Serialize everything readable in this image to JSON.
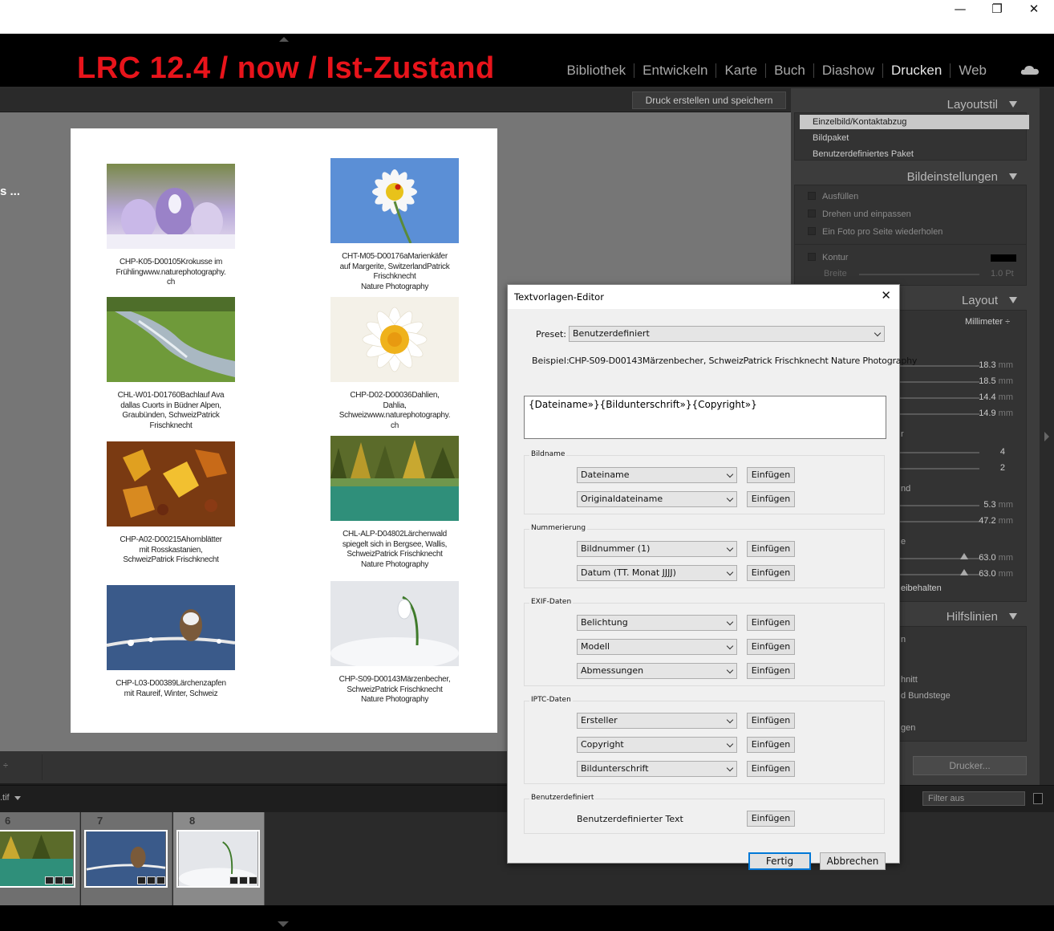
{
  "window": {
    "minimize_glyph": "—",
    "restore_glyph": "❐",
    "close_glyph": "✕"
  },
  "brand_title": "LRC 12.4 / now / Ist-Zustand",
  "modules": [
    "Bibliothek",
    "Entwickeln",
    "Karte",
    "Buch",
    "Diashow",
    "Drucken",
    "Web"
  ],
  "active_module": "Drucken",
  "toolbar": {
    "print_save_label": "Druck erstellen und speichern"
  },
  "canvas_left_text": "s ...",
  "page_cells": [
    {
      "caption": "CHP-K05-D00105Krokusse im\nFrühlingwww.naturephotography.\nch"
    },
    {
      "caption": "CHT-M05-D00176aMarienkäfer\nauf Margerite, SwitzerlandPatrick\nFrischknecht\nNature Photography"
    },
    {
      "caption": "CHL-W01-D01760Bachlauf Ava\ndallas Cuorts in Büdner Alpen,\nGraubünden, SchweizPatrick\nFrischknecht"
    },
    {
      "caption": "CHP-D02-D00036Dahlien,\nDahlia,\nSchweizwww.naturephotography.\nch"
    },
    {
      "caption": "CHP-A02-D00215Ahornblätter\nmit Rosskastanien,\nSchweizPatrick Frischknecht"
    },
    {
      "caption": "CHL-ALP-D04802Lärchenwald\nspiegelt sich in Bergsee, Wallis,\nSchweizPatrick Frischknecht\nNature Photography"
    },
    {
      "caption": "CHP-L03-D00389Lärchenzapfen\nmit Raureif, Winter, Schweiz"
    },
    {
      "caption": "CHP-S09-D00143Märzenbecher,\nSchweizPatrick Frischknecht\nNature Photography"
    }
  ],
  "right_panel": {
    "layout_style": {
      "title": "Layoutstil",
      "items": [
        "Einzelbild/Kontaktabzug",
        "Bildpaket",
        "Benutzerdefiniertes Paket"
      ],
      "selected": "Einzelbild/Kontaktabzug"
    },
    "image_settings": {
      "title": "Bildeinstellungen",
      "checkboxes": [
        "Ausfüllen",
        "Drehen und einpassen",
        "Ein Foto pro Seite wiederholen"
      ],
      "stroke_label": "Kontur",
      "width_label": "Breite",
      "width_value": "1.0 Pt"
    },
    "layout": {
      "title": "Layout",
      "unit": "Millimeter ÷",
      "margins": [
        {
          "value": "18.3",
          "unit": "mm"
        },
        {
          "value": "18.5",
          "unit": "mm"
        },
        {
          "value": "14.4",
          "unit": "mm"
        },
        {
          "value": "14.9",
          "unit": "mm"
        }
      ],
      "grid_label_fragment": "r",
      "grid": [
        "4",
        "2"
      ],
      "spacing_label_fragment": "nd",
      "spacing": [
        {
          "value": "5.3",
          "unit": "mm"
        },
        {
          "value": "47.2",
          "unit": "mm"
        }
      ],
      "cell_label_fragment": "e",
      "cell": [
        {
          "value": "63.0",
          "unit": "mm"
        },
        {
          "value": "63.0",
          "unit": "mm"
        }
      ],
      "keep_square_fragment": "eibehalten"
    },
    "guides": {
      "title": "Hilfslinien",
      "fragments": [
        "n",
        "hnitt",
        "d Bundstege",
        "gen"
      ]
    },
    "printer_button": "Drucker...",
    "filter_label": "Filter aus"
  },
  "filmstrip": {
    "source_fragment": ".tif",
    "items": [
      {
        "num": "6"
      },
      {
        "num": "7"
      },
      {
        "num": "8"
      }
    ]
  },
  "dialog": {
    "title": "Textvorlagen-Editor",
    "close_glyph": "✕",
    "preset_label": "Preset:",
    "preset_value": "Benutzerdefiniert",
    "example_label": "Beispiel:",
    "example_value": "CHP-S09-D00143Märzenbecher, SchweizPatrick Frischknecht Nature Photography",
    "template": "{Dateiname»}{Bildunterschrift»}{Copyright»}",
    "insert_label": "Einfügen",
    "groups": [
      {
        "title": "Bildname",
        "selects": [
          "Dateiname",
          "Originaldateiname"
        ]
      },
      {
        "title": "Nummerierung",
        "selects": [
          "Bildnummer (1)",
          "Datum (TT. Monat JJJJ)"
        ]
      },
      {
        "title": "EXIF-Daten",
        "selects": [
          "Belichtung",
          "Modell",
          "Abmessungen"
        ]
      },
      {
        "title": "IPTC-Daten",
        "selects": [
          "Ersteller",
          "Copyright",
          "Bildunterschrift"
        ]
      }
    ],
    "custom_group": {
      "title": "Benutzerdefiniert",
      "text_label": "Benutzerdefinierter Text"
    },
    "done_label": "Fertig",
    "cancel_label": "Abbrechen"
  }
}
